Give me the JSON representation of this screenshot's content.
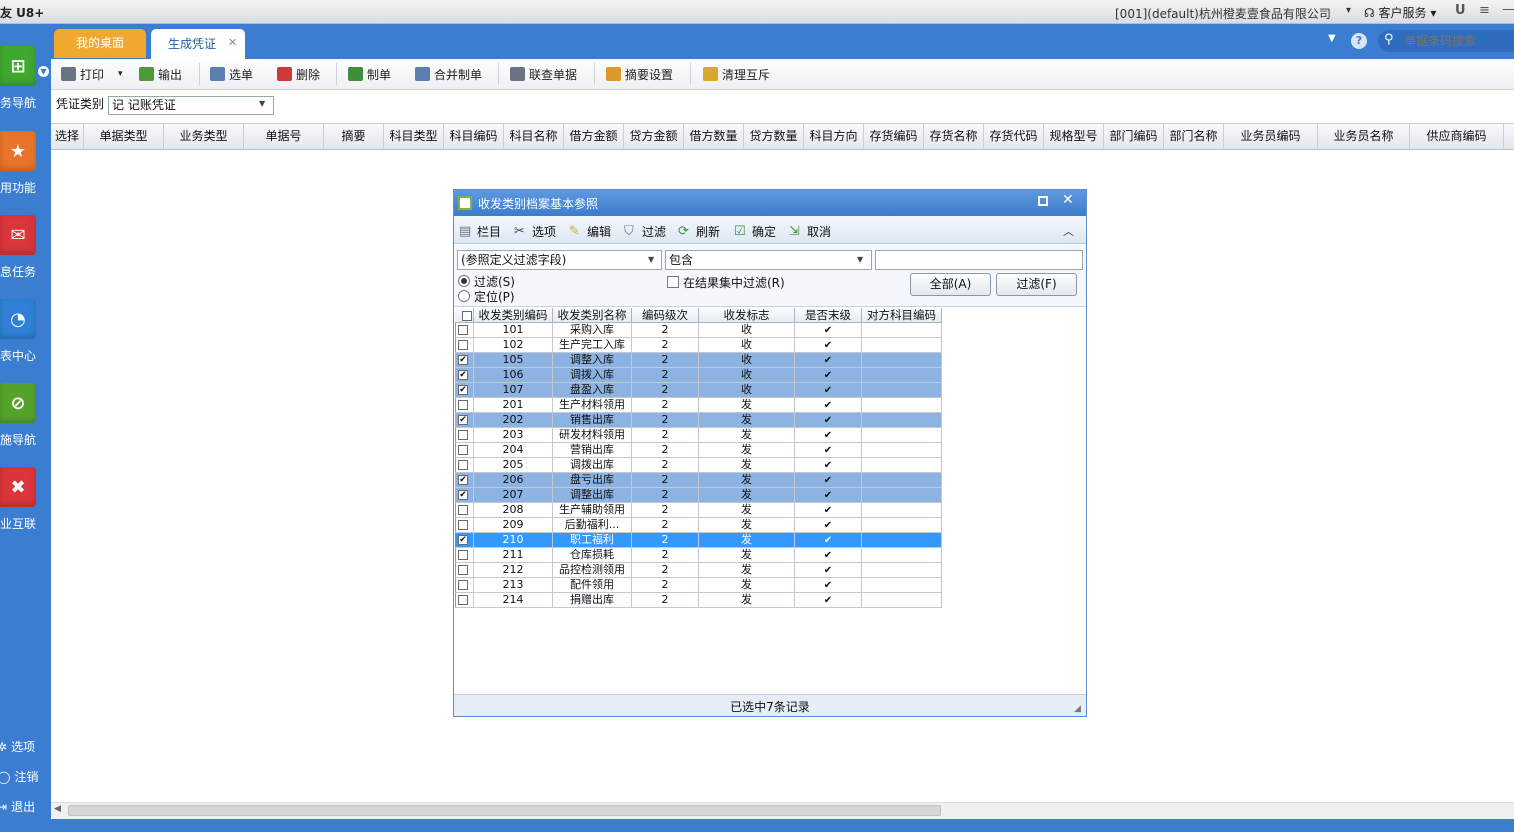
{
  "app": {
    "title": "友 U8+",
    "company": "[001](default)杭州橙麦壹食品有限公司",
    "support": "客户服务"
  },
  "sidebar": {
    "items": [
      {
        "label": "业务导航",
        "icon": "business-nav-icon",
        "color": "#3fa82f"
      },
      {
        "label": "常用功能",
        "icon": "star-icon",
        "color": "#e8742a"
      },
      {
        "label": "消息任务",
        "icon": "mail-icon",
        "color": "#d9353b"
      },
      {
        "label": "报表中心",
        "icon": "report-icon",
        "color": "#2f80d6"
      },
      {
        "label": "实施导航",
        "icon": "compass-icon",
        "color": "#56a32b"
      },
      {
        "label": "企业互联",
        "icon": "link-icon",
        "color": "#d9353b"
      }
    ],
    "bottom": [
      {
        "label": "选项",
        "icon": "gear-icon"
      },
      {
        "label": "注销",
        "icon": "logout-icon"
      },
      {
        "label": "退出",
        "icon": "exit-icon"
      }
    ]
  },
  "tabs": [
    {
      "label": "我的桌面"
    },
    {
      "label": "生成凭证"
    }
  ],
  "search": {
    "placeholder": "单据条码搜索"
  },
  "toolbar": [
    {
      "label": "打印",
      "icon": "print-icon"
    },
    {
      "label": "输出",
      "icon": "export-icon"
    },
    {
      "label": "选单",
      "icon": "select-doc-icon"
    },
    {
      "label": "删除",
      "icon": "delete-icon"
    },
    {
      "label": "制单",
      "icon": "make-voucher-icon"
    },
    {
      "label": "合并制单",
      "icon": "merge-voucher-icon"
    },
    {
      "label": "联查单据",
      "icon": "query-doc-icon"
    },
    {
      "label": "摘要设置",
      "icon": "summary-settings-icon"
    },
    {
      "label": "清理互斥",
      "icon": "clean-icon"
    }
  ],
  "voucher_filter": {
    "label": "凭证类别",
    "value": "记 记账凭证"
  },
  "grid": {
    "columns": [
      "选择",
      "单据类型",
      "业务类型",
      "单据号",
      "摘要",
      "科目类型",
      "科目编码",
      "科目名称",
      "借方金额",
      "贷方金额",
      "借方数量",
      "贷方数量",
      "科目方向",
      "存货编码",
      "存货名称",
      "存货代码",
      "规格型号",
      "部门编码",
      "部门名称",
      "业务员编码",
      "业务员名称",
      "供应商编码"
    ]
  },
  "dialog": {
    "title": "收发类别档案基本参照",
    "tools": [
      {
        "label": "栏目",
        "icon": "columns-icon"
      },
      {
        "label": "选项",
        "icon": "options-icon"
      },
      {
        "label": "编辑",
        "icon": "edit-icon"
      },
      {
        "label": "过滤",
        "icon": "funnel-icon"
      },
      {
        "label": "刷新",
        "icon": "refresh-icon"
      },
      {
        "label": "确定",
        "icon": "confirm-icon"
      },
      {
        "label": "取消",
        "icon": "cancel-icon"
      }
    ],
    "field_select": "(参照定义过滤字段)",
    "operator": "包含",
    "value": "",
    "radio_filter": "过滤(S)",
    "radio_locate": "定位(P)",
    "filter_in_result": "在结果集中过滤(R)",
    "btn_all": "全部(A)",
    "btn_filter": "过滤(F)",
    "columns": [
      "收发类别编码",
      "收发类别名称",
      "编码级次",
      "收发标志",
      "是否末级",
      "对方科目编码"
    ],
    "rows": [
      {
        "checked": false,
        "state": "normal",
        "code": "101",
        "name": "采购入库",
        "level": "2",
        "flag": "收",
        "leaf": true,
        "acct": ""
      },
      {
        "checked": false,
        "state": "normal",
        "code": "102",
        "name": "生产完工入库",
        "level": "2",
        "flag": "收",
        "leaf": true,
        "acct": ""
      },
      {
        "checked": true,
        "state": "selected",
        "code": "105",
        "name": "调整入库",
        "level": "2",
        "flag": "收",
        "leaf": true,
        "acct": ""
      },
      {
        "checked": true,
        "state": "selected",
        "code": "106",
        "name": "调拨入库",
        "level": "2",
        "flag": "收",
        "leaf": true,
        "acct": ""
      },
      {
        "checked": true,
        "state": "selected",
        "code": "107",
        "name": "盘盈入库",
        "level": "2",
        "flag": "收",
        "leaf": true,
        "acct": ""
      },
      {
        "checked": false,
        "state": "normal",
        "code": "201",
        "name": "生产材料领用",
        "level": "2",
        "flag": "发",
        "leaf": true,
        "acct": ""
      },
      {
        "checked": true,
        "state": "selected",
        "code": "202",
        "name": "销售出库",
        "level": "2",
        "flag": "发",
        "leaf": true,
        "acct": ""
      },
      {
        "checked": false,
        "state": "normal",
        "code": "203",
        "name": "研发材料领用",
        "level": "2",
        "flag": "发",
        "leaf": true,
        "acct": ""
      },
      {
        "checked": false,
        "state": "normal",
        "code": "204",
        "name": "营销出库",
        "level": "2",
        "flag": "发",
        "leaf": true,
        "acct": ""
      },
      {
        "checked": false,
        "state": "normal",
        "code": "205",
        "name": "调拨出库",
        "level": "2",
        "flag": "发",
        "leaf": true,
        "acct": ""
      },
      {
        "checked": true,
        "state": "selected",
        "code": "206",
        "name": "盘亏出库",
        "level": "2",
        "flag": "发",
        "leaf": true,
        "acct": ""
      },
      {
        "checked": true,
        "state": "selected",
        "code": "207",
        "name": "调整出库",
        "level": "2",
        "flag": "发",
        "leaf": true,
        "acct": ""
      },
      {
        "checked": false,
        "state": "normal",
        "code": "208",
        "name": "生产辅助领用",
        "level": "2",
        "flag": "发",
        "leaf": true,
        "acct": ""
      },
      {
        "checked": false,
        "state": "normal",
        "code": "209",
        "name": "后勤福利...",
        "level": "2",
        "flag": "发",
        "leaf": true,
        "acct": ""
      },
      {
        "checked": true,
        "state": "current",
        "code": "210",
        "name": "职工福利",
        "level": "2",
        "flag": "发",
        "leaf": true,
        "acct": ""
      },
      {
        "checked": false,
        "state": "normal",
        "code": "211",
        "name": "仓库损耗",
        "level": "2",
        "flag": "发",
        "leaf": true,
        "acct": ""
      },
      {
        "checked": false,
        "state": "normal",
        "code": "212",
        "name": "品控检测领用",
        "level": "2",
        "flag": "发",
        "leaf": true,
        "acct": ""
      },
      {
        "checked": false,
        "state": "normal",
        "code": "213",
        "name": "配件领用",
        "level": "2",
        "flag": "发",
        "leaf": true,
        "acct": ""
      },
      {
        "checked": false,
        "state": "normal",
        "code": "214",
        "name": "捐赠出库",
        "level": "2",
        "flag": "发",
        "leaf": true,
        "acct": ""
      }
    ],
    "status": "已选中7条记录"
  },
  "colors": {
    "accent": "#3b7dd1",
    "tab_active_bg": "#f0a830",
    "row_selected": "#8db3e2",
    "row_current": "#3399ff"
  }
}
